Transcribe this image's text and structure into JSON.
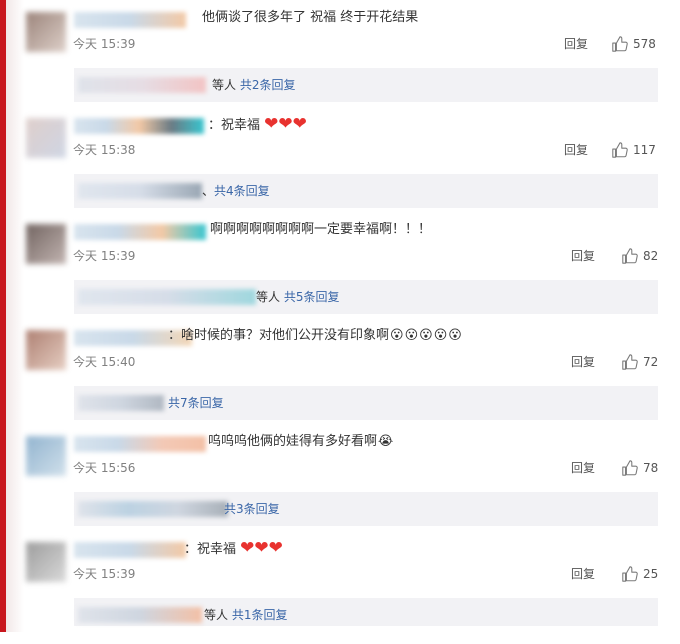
{
  "comments": [
    {
      "text": "他俩谈了很多年了 祝福 终于开花结果",
      "time": "今天 15:39",
      "reply": "回复",
      "likes": "578",
      "sub_prefix": "等人",
      "sub_link": "共2条回复",
      "hearts": [],
      "emojis": []
    },
    {
      "text": "：祝幸福",
      "time": "今天 15:38",
      "reply": "回复",
      "likes": "117",
      "sub_prefix": "、",
      "sub_link": "共4条回复",
      "hearts": [
        "❤",
        "❤",
        "❤"
      ],
      "emojis": []
    },
    {
      "text": "啊啊啊啊啊啊啊啊一定要幸福啊！！！",
      "time": "今天 15:39",
      "reply": "回复",
      "likes": "82",
      "sub_prefix": "等人",
      "sub_link": "共5条回复",
      "hearts": [],
      "emojis": []
    },
    {
      "text": "：啥时候的事？对他们公开没有印象啊",
      "time": "今天 15:40",
      "reply": "回复",
      "likes": "72",
      "sub_prefix": "",
      "sub_link": "共7条回复",
      "hearts": [],
      "emojis": [
        "😮",
        "😮",
        "😮",
        "😮",
        "😮"
      ]
    },
    {
      "text": "呜呜呜他俩的娃得有多好看啊",
      "time": "今天 15:56",
      "reply": "回复",
      "likes": "78",
      "sub_prefix": "",
      "sub_link": "共3条回复",
      "hearts": [],
      "emojis": [
        "😭"
      ]
    },
    {
      "text": "：祝幸福",
      "time": "今天 15:39",
      "reply": "回复",
      "likes": "25",
      "sub_prefix": "等人",
      "sub_link": "共1条回复",
      "hearts": [
        "❤",
        "❤",
        "❤"
      ],
      "emojis": []
    }
  ],
  "colors": {
    "link": "#3b67a8",
    "heart": "#e8322f",
    "accent_bar": "#c8161d",
    "sub_bg": "#f2f2f5"
  },
  "icons": {
    "like": "thumbs-up-icon",
    "heart": "heart-icon",
    "emoji": "surprised-face-icon"
  }
}
